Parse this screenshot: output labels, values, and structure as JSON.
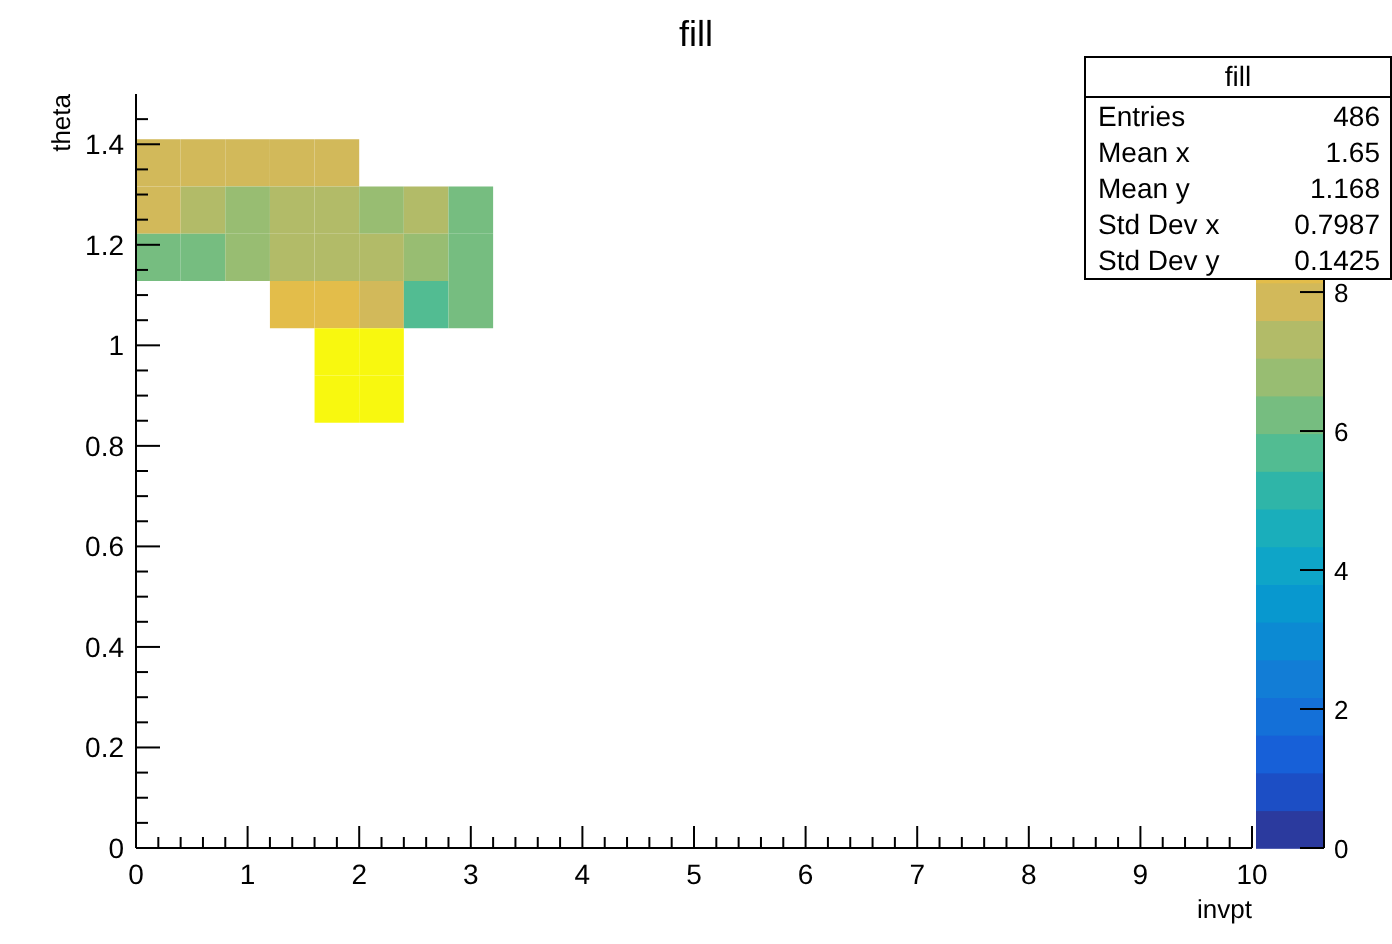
{
  "title": "fill",
  "stats": {
    "title": "fill",
    "rows": [
      {
        "label": "Entries",
        "value": "486"
      },
      {
        "label": "Mean x",
        "value": "1.65"
      },
      {
        "label": "Mean y",
        "value": "1.168"
      },
      {
        "label": "Std Dev x",
        "value": "0.7987"
      },
      {
        "label": "Std Dev y",
        "value": "0.1425"
      }
    ]
  },
  "histogram": {
    "xlabel": "invpt",
    "ylabel": "theta",
    "xticks": [
      "0",
      "1",
      "2",
      "3",
      "4",
      "5",
      "6",
      "7",
      "8",
      "9",
      "10"
    ],
    "yticks": [
      "1.4",
      "1.2",
      "1",
      "0.8",
      "0.6",
      "0.4",
      "0.2",
      "0"
    ],
    "zticks": [
      "8",
      "6",
      "4",
      "2",
      "0"
    ],
    "rows": [
      [
        {
          "color": "#d2b95a"
        },
        {
          "color": "#d2b95a"
        },
        {
          "color": "#d2b95a"
        },
        {
          "color": "#d2b95a"
        },
        {
          "color": "#d2b95a"
        },
        null,
        null,
        null
      ],
      [
        {
          "color": "#d2b95a"
        },
        {
          "color": "#b2bb68"
        },
        {
          "color": "#98bd72"
        },
        {
          "color": "#b2bb68"
        },
        {
          "color": "#b2bb68"
        },
        {
          "color": "#98bd72"
        },
        {
          "color": "#b2bb68"
        },
        {
          "color": "#76bd80"
        }
      ],
      [
        {
          "color": "#76bd80"
        },
        {
          "color": "#76bd80"
        },
        {
          "color": "#98bd72"
        },
        {
          "color": "#b2bb68"
        },
        {
          "color": "#b2bb68"
        },
        {
          "color": "#b2bb68"
        },
        {
          "color": "#98bd72"
        },
        {
          "color": "#76bd80"
        }
      ],
      [
        null,
        null,
        null,
        {
          "color": "#e3bd4a"
        },
        {
          "color": "#e3bd4a"
        },
        {
          "color": "#d2b95a"
        },
        {
          "color": "#52bc92"
        },
        {
          "color": "#76bd80"
        }
      ],
      [
        null,
        null,
        null,
        null,
        {
          "color": "#f8f80f"
        },
        {
          "color": "#f8f80f"
        },
        null,
        null
      ],
      [
        null,
        null,
        null,
        null,
        {
          "color": "#f8f80f"
        },
        {
          "color": "#f8f80f"
        },
        null,
        null
      ]
    ]
  }
}
